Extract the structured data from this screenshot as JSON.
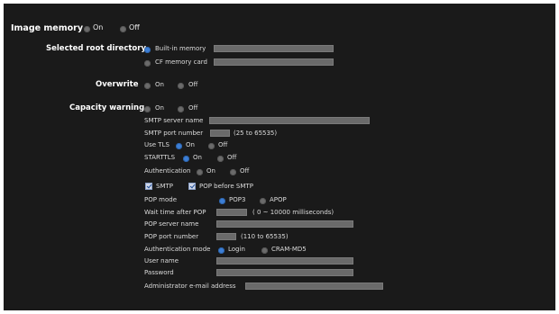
{
  "image_memory": {
    "label": "Image memory",
    "on": "On",
    "off": "Off",
    "selected": "off"
  },
  "root_dir": {
    "label": "Selected root directory",
    "builtin": "Built-in memory",
    "cf": "CF memory card",
    "selected": "builtin"
  },
  "overwrite": {
    "label": "Overwrite",
    "on": "On",
    "off": "Off",
    "selected": "none"
  },
  "capacity": {
    "label": "Capacity warning",
    "on": "On",
    "off": "Off",
    "smtp_server": "SMTP server name",
    "smtp_port": "SMTP port number",
    "smtp_port_hint": "(25 to 65535)",
    "tls": {
      "label": "Use TLS",
      "on": "On",
      "off": "Off",
      "selected": "on"
    },
    "starttls": {
      "label": "STARTTLS",
      "on": "On",
      "off": "Off",
      "selected": "on"
    },
    "auth": {
      "label": "Authentication",
      "on": "On",
      "off": "Off"
    },
    "smtp_check": "SMTP",
    "pop_before_smtp_check": "POP before SMTP",
    "pop_mode": {
      "label": "POP mode",
      "pop3": "POP3",
      "apop": "APOP",
      "selected": "pop3"
    },
    "wait_time": "Wait time after POP",
    "wait_time_hint": "( 0 ~ 10000 milliseconds)",
    "pop_server": "POP server name",
    "pop_port": "POP port number",
    "pop_port_hint": "(110 to 65535)",
    "auth_mode": {
      "label": "Authentication mode",
      "login": "Login",
      "cram": "CRAM-MD5",
      "selected": "login"
    },
    "user_name": "User name",
    "password": "Password",
    "admin_email": "Administrator e-mail address"
  },
  "colors": {
    "panel_bg": "#1a1a1a",
    "radio_on": "#3d7fd6",
    "field_bg": "#6a6a6a"
  }
}
